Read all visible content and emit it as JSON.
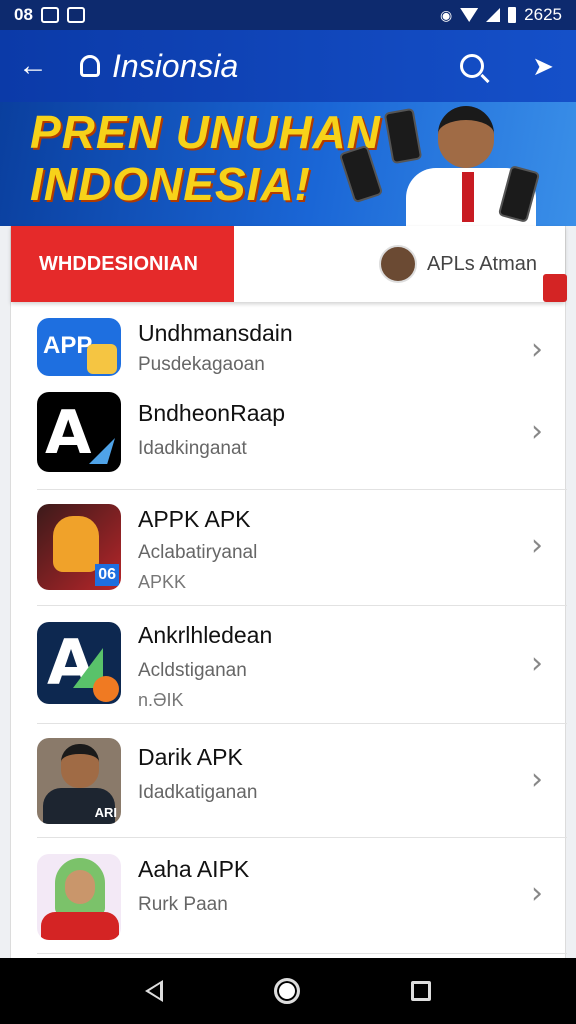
{
  "status_bar": {
    "left": "08",
    "time": "2625"
  },
  "app_bar": {
    "title": "Insionsia"
  },
  "banner": {
    "headline_line1": "PREN UNUHAN",
    "headline_line2": "INDONESIA!"
  },
  "tabs": {
    "active": "WHDDESIONIAN",
    "side": "APLs Atman"
  },
  "apps": [
    {
      "name": "Undhmansdain",
      "sub": "Pusdekagaoan",
      "sub2": ""
    },
    {
      "name": "BndheonRaap",
      "sub": "Idadkinganat",
      "sub2": ""
    },
    {
      "name": "APPK APK",
      "sub": "Aclabatiryanal",
      "sub2": "APKK"
    },
    {
      "name": "Ankrlhledean",
      "sub": "Acldstiganan",
      "sub2": "n.ӘIK"
    },
    {
      "name": "Darik APK",
      "sub": "Idadkatiganan",
      "sub2": ""
    },
    {
      "name": "Aaha AIPK",
      "sub": "Rurk Paan",
      "sub2": ""
    }
  ],
  "icons": {
    "back": "arrow-left-icon",
    "bell": "bell-icon",
    "search": "search-icon",
    "share": "share-icon",
    "chevron": "chevron-right-icon",
    "nav_back": "triangle-back-icon",
    "nav_home": "circle-home-icon",
    "nav_recent": "square-recent-icon"
  },
  "icon_texts": {
    "app1": "APP",
    "app3": "06",
    "app5": "ARI"
  },
  "colors": {
    "app_bar": "#1550c9",
    "tab_active": "#e52a2a",
    "headline": "#f7d21a"
  }
}
